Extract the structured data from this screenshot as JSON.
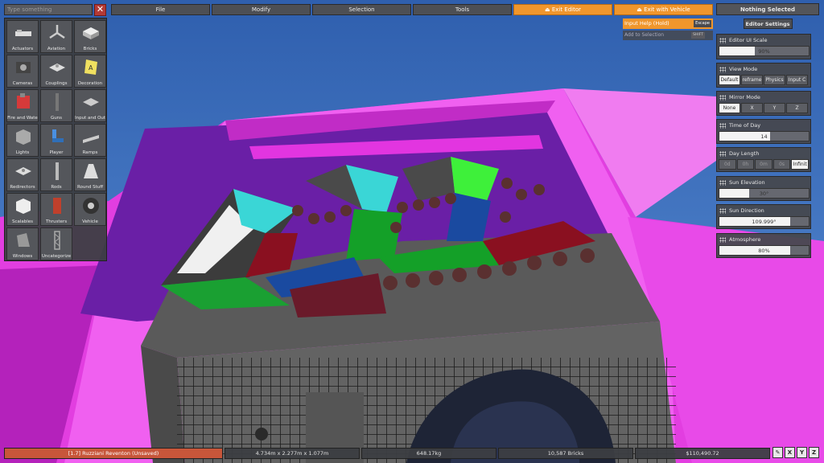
{
  "search": {
    "placeholder": "Type something"
  },
  "menu": [
    {
      "label": "File"
    },
    {
      "label": "Modify"
    },
    {
      "label": "Selection"
    },
    {
      "label": "Tools"
    },
    {
      "label": "Exit Editor"
    },
    {
      "label": "Exit with Vehicle"
    }
  ],
  "categories": [
    {
      "label": "Actuators",
      "icon": "actuator-icon"
    },
    {
      "label": "Aviation",
      "icon": "propeller-icon"
    },
    {
      "label": "Bricks",
      "icon": "brick-icon"
    },
    {
      "label": "Cameras",
      "icon": "camera-icon"
    },
    {
      "label": "Couplings",
      "icon": "coupling-icon"
    },
    {
      "label": "Decoration",
      "icon": "decoration-icon"
    },
    {
      "label": "Fire and Wate",
      "icon": "fire-icon"
    },
    {
      "label": "Guns",
      "icon": "gun-icon"
    },
    {
      "label": "Input and Out",
      "icon": "io-icon"
    },
    {
      "label": "Lights",
      "icon": "light-icon"
    },
    {
      "label": "Player",
      "icon": "seat-icon"
    },
    {
      "label": "Ramps",
      "icon": "ramp-icon"
    },
    {
      "label": "Redirectors",
      "icon": "redirector-icon"
    },
    {
      "label": "Rods",
      "icon": "rod-icon"
    },
    {
      "label": "Round Stuff",
      "icon": "cone-icon"
    },
    {
      "label": "Scalables",
      "icon": "cube-icon"
    },
    {
      "label": "Thrusters",
      "icon": "thruster-icon"
    },
    {
      "label": "Vehicle",
      "icon": "wheel-icon"
    },
    {
      "label": "Windows",
      "icon": "window-icon"
    },
    {
      "label": "Uncategorize",
      "icon": "truss-icon"
    }
  ],
  "input_help": {
    "label": "Input Help (Hold)",
    "key": "Escape",
    "add_label": "Add to Selection",
    "add_key": "SHIFT"
  },
  "right_panel": {
    "title": "Nothing Selected",
    "settings_button": "Editor Settings",
    "ui_scale": {
      "label": "Editor UI Scale",
      "value": "90%",
      "level": 0.4
    },
    "view_mode": {
      "label": "View Mode",
      "options": [
        "Default",
        "reframe",
        "Physics",
        "Input C"
      ],
      "selected": 0
    },
    "mirror_mode": {
      "label": "Mirror Mode",
      "options": [
        "None",
        "X",
        "Y",
        "Z"
      ],
      "selected": 0
    },
    "time_of_day": {
      "label": "Time of Day",
      "value": "14",
      "level": 0.57
    },
    "day_length": {
      "label": "Day Length",
      "options": [
        "0d",
        "0h",
        "0m",
        "0s",
        "Infinit"
      ],
      "selected": 4
    },
    "sun_elevation": {
      "label": "Sun Elevation",
      "value": "30°",
      "level": 0.33
    },
    "sun_direction": {
      "label": "Sun Direction",
      "value": "109.999°",
      "level": 0.79
    },
    "atmosphere": {
      "label": "Atmosphere",
      "value": "80%",
      "level": 0.79
    }
  },
  "status_bar": {
    "vehicle": "[1.7] Ruzziani Reventon (Unsaved)",
    "dimensions": "4.734m x 2.277m x 1.077m",
    "mass": "648.17kg",
    "bricks": "10,587 Bricks",
    "cost": "$110,490.72"
  },
  "colors": {
    "accent": "#f0962c",
    "vehicle_bar": "#c8563a",
    "panel": "#46484e",
    "scene_magenta": "#e21ee0",
    "sky": "#3a6cbf"
  }
}
